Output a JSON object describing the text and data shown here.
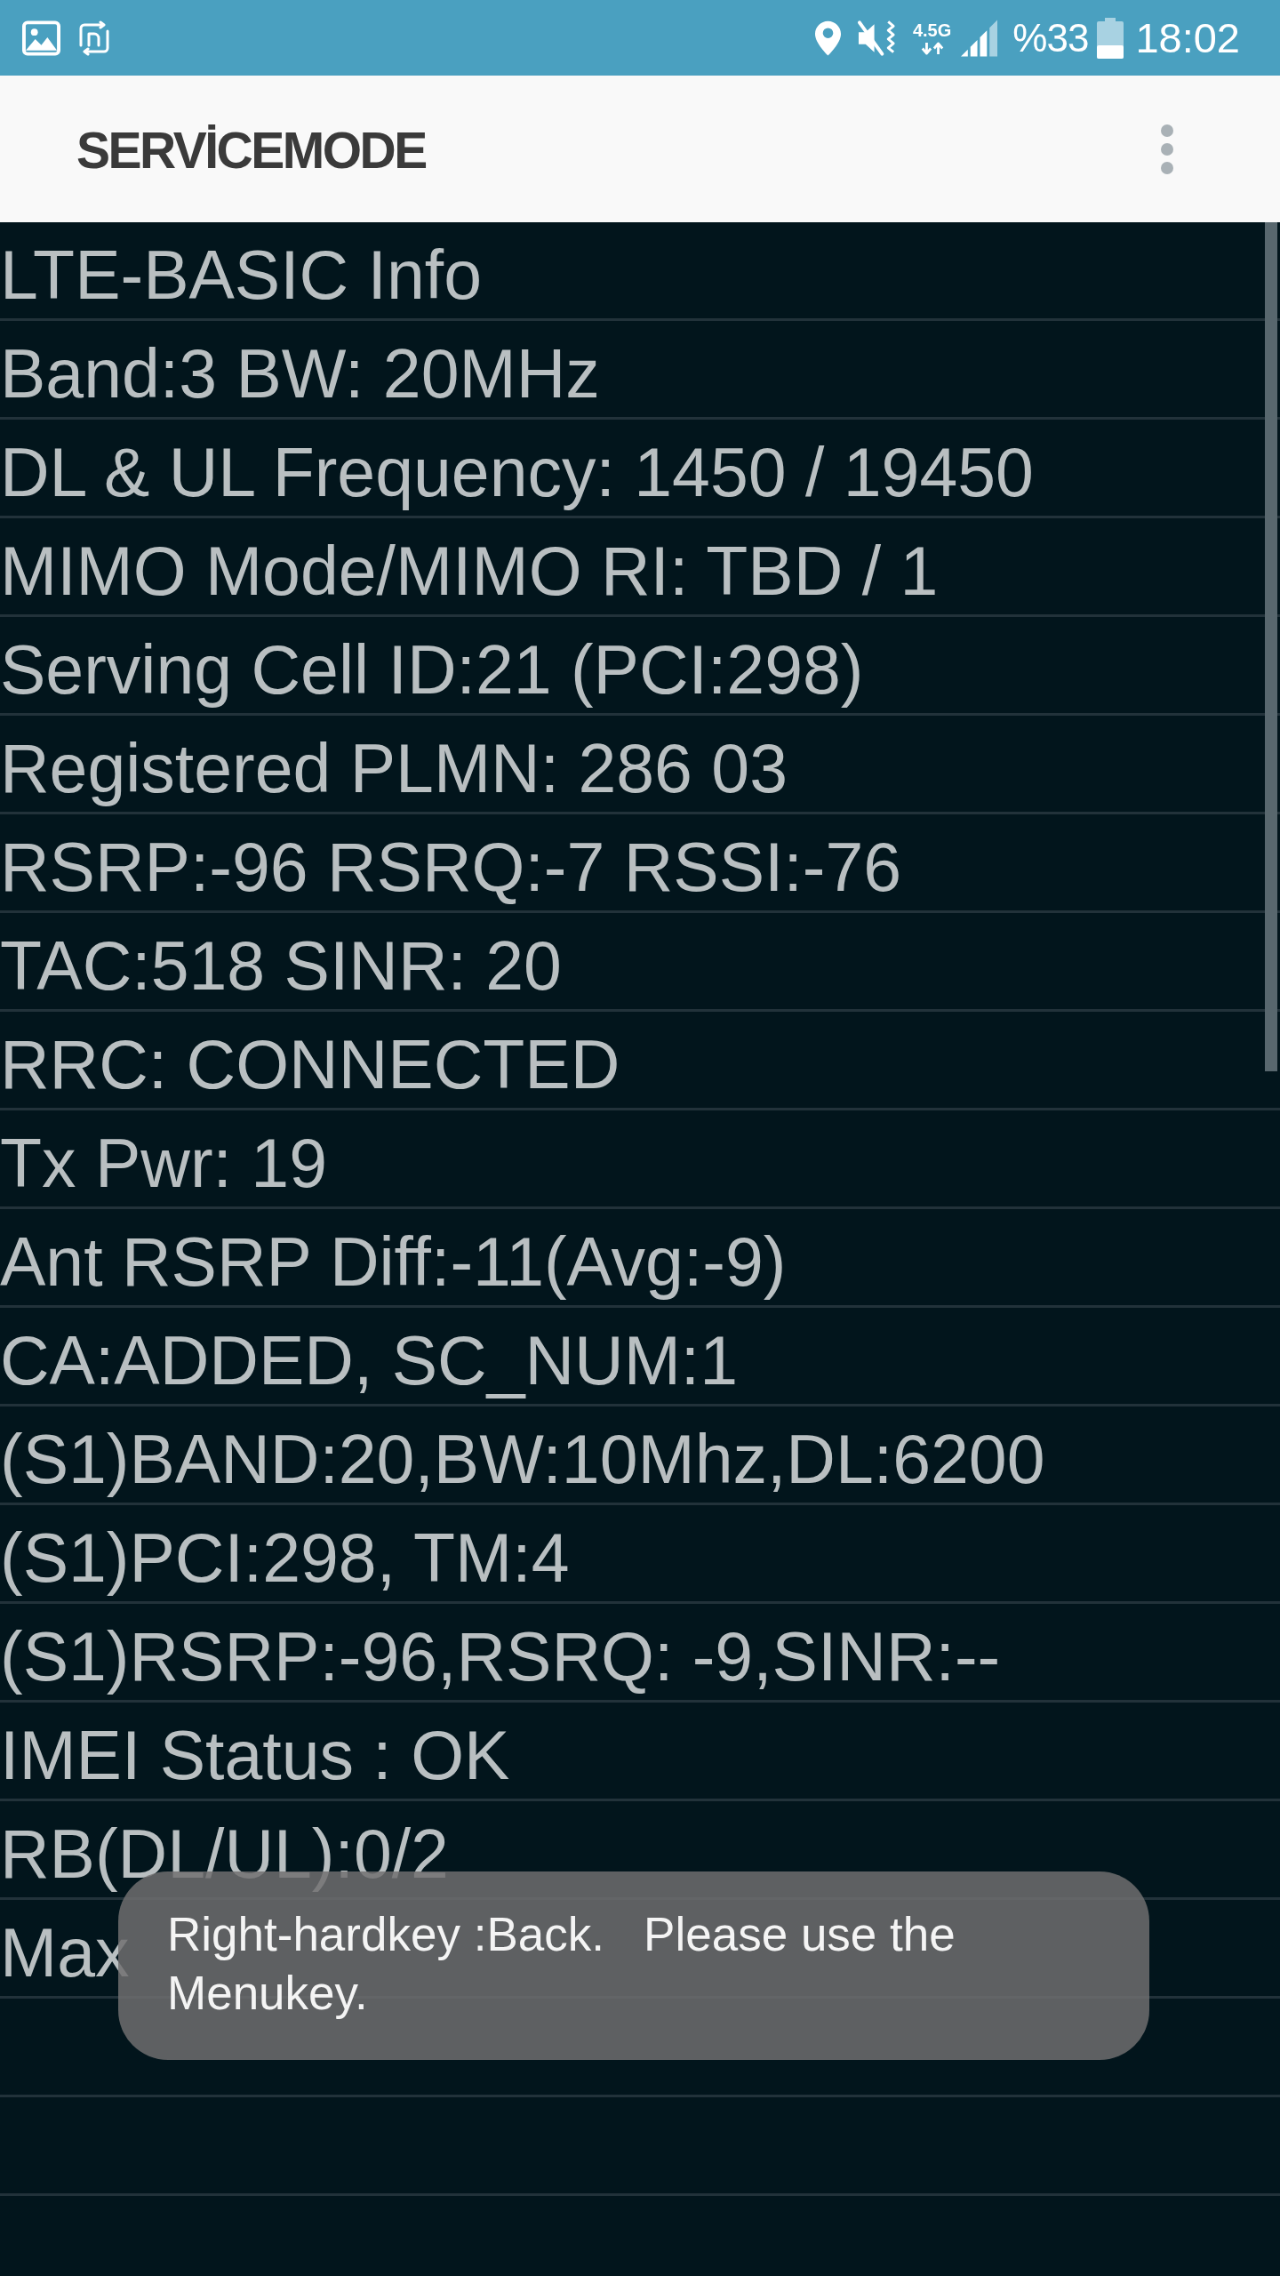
{
  "status_bar": {
    "network_type": "4.5G",
    "battery_percent": "%33",
    "time": "18:02"
  },
  "app_bar": {
    "title": "SERVİCEMODE"
  },
  "rows": [
    "LTE-BASIC Info",
    "Band:3 BW: 20MHz",
    "DL & UL Frequency: 1450 / 19450",
    "MIMO Mode/MIMO RI: TBD / 1",
    "Serving Cell ID:21 (PCI:298)",
    "Registered PLMN: 286 03",
    "RSRP:-96 RSRQ:-7 RSSI:-76",
    "TAC:518 SINR: 20",
    "RRC: CONNECTED",
    "Tx Pwr: 19",
    "Ant RSRP Diff:-11(Avg:-9)",
    "CA:ADDED, SC_NUM:1",
    "(S1)BAND:20,BW:10Mhz,DL:6200",
    "(S1)PCI:298, TM:4",
    "(S1)RSRP:-96,RSRQ: -9,SINR:--",
    "IMEI Status : OK",
    "RB(DL/UL):0/2",
    "Max"
  ],
  "toast": {
    "message": "Right-hardkey :Back.   Please use the Menukey."
  }
}
